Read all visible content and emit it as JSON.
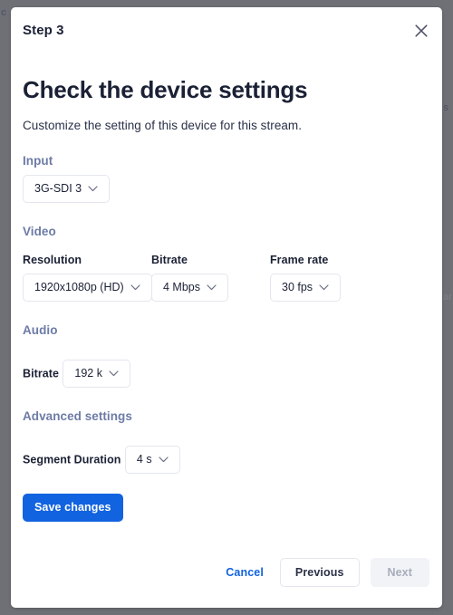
{
  "background": {
    "overlay_color": "#6e7076",
    "fragment_left": "c",
    "fragment_right": "s",
    "fragment_right_lower": "ar"
  },
  "modal": {
    "step_label": "Step 3",
    "close_icon": "close-icon",
    "title": "Check the device settings",
    "subtitle": "Customize the setting of this device for this stream.",
    "sections": {
      "input": {
        "heading": "Input",
        "select": {
          "value": "3G-SDI 3",
          "icon": "chevron-down-icon"
        }
      },
      "video": {
        "heading": "Video",
        "fields": [
          {
            "label": "Resolution",
            "value": "1920x1080p (HD)",
            "icon": "chevron-down-icon"
          },
          {
            "label": "Bitrate",
            "value": "4 Mbps",
            "icon": "chevron-down-icon"
          },
          {
            "label": "Frame rate",
            "value": "30 fps",
            "icon": "chevron-down-icon"
          }
        ]
      },
      "audio": {
        "heading": "Audio",
        "field": {
          "label": "Bitrate",
          "value": "192 k",
          "icon": "chevron-down-icon"
        }
      },
      "advanced": {
        "heading": "Advanced settings",
        "field": {
          "label": "Segment Duration",
          "value": "4 s",
          "icon": "chevron-down-icon"
        }
      }
    },
    "save_label": "Save changes",
    "footer": {
      "cancel_label": "Cancel",
      "previous_label": "Previous",
      "next_label": "Next"
    }
  },
  "colors": {
    "primary": "#1263e0",
    "text": "#1b2135",
    "section_heading": "#6d7ba6",
    "border": "#e3e6ee",
    "disabled_bg": "#f1f3f7",
    "disabled_text": "#a8adbb"
  }
}
